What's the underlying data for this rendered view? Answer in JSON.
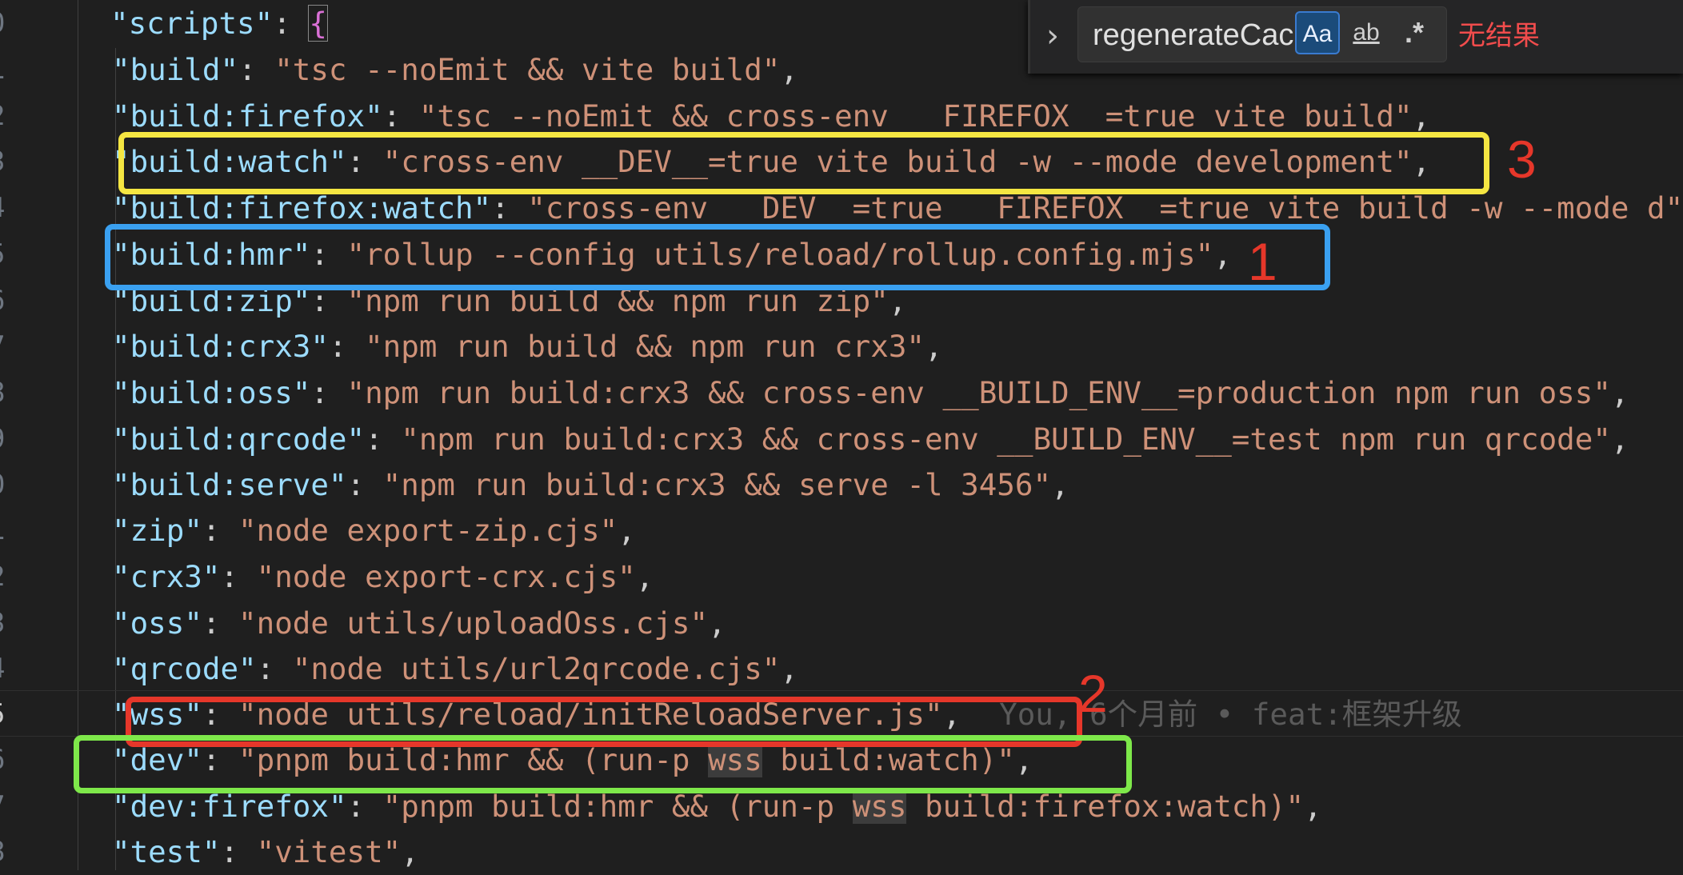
{
  "find_widget": {
    "query": "regenerateCac",
    "options": {
      "match_case": "Aa",
      "whole_word": "ab",
      "regex": ".*"
    },
    "result": "无结果"
  },
  "lines": [
    {
      "n": "0",
      "key": "scripts",
      "value": ""
    },
    {
      "n": "1",
      "key": "build",
      "value": "tsc --noEmit && vite build"
    },
    {
      "n": "2",
      "key": "build:firefox",
      "value": "tsc --noEmit && cross-env __FIREFOX__=true vite build"
    },
    {
      "n": "3",
      "key": "build:watch",
      "value": "cross-env __DEV__=true vite build -w --mode development"
    },
    {
      "n": "4",
      "key": "build:firefox:watch",
      "value": "cross-env __DEV__=true __FIREFOX__=true vite build -w --mode d"
    },
    {
      "n": "5",
      "key": "build:hmr",
      "value": "rollup --config utils/reload/rollup.config.mjs"
    },
    {
      "n": "6",
      "key": "build:zip",
      "value": "npm run build && npm run zip"
    },
    {
      "n": "7",
      "key": "build:crx3",
      "value": "npm run build && npm run crx3"
    },
    {
      "n": "8",
      "key": "build:oss",
      "value": "npm run build:crx3 && cross-env __BUILD_ENV__=production npm run oss"
    },
    {
      "n": "9",
      "key": "build:qrcode",
      "value": "npm run build:crx3 && cross-env __BUILD_ENV__=test npm run qrcode"
    },
    {
      "n": "0",
      "key": "build:serve",
      "value": "npm run build:crx3 && serve -l 3456"
    },
    {
      "n": "1",
      "key": "zip",
      "value": "node export-zip.cjs"
    },
    {
      "n": "2",
      "key": "crx3",
      "value": "node export-crx.cjs"
    },
    {
      "n": "3",
      "key": "oss",
      "value": "node utils/uploadOss.cjs"
    },
    {
      "n": "4",
      "key": "qrcode",
      "value": "node utils/url2qrcode.cjs"
    },
    {
      "n": "5",
      "key": "wss",
      "value": "node utils/reload/initReloadServer.js"
    },
    {
      "n": "6",
      "key": "dev",
      "value": "pnpm build:hmr && (run-p wss build:watch)"
    },
    {
      "n": "7",
      "key": "dev:firefox",
      "value": "pnpm build:hmr && (run-p wss build:firefox:watch)"
    },
    {
      "n": "8",
      "key": "test",
      "value": "vitest"
    }
  ],
  "blame": "You, 6个月前 • feat:框架升级",
  "annotations": [
    {
      "number": "3",
      "color": "#f5e642"
    },
    {
      "number": "1",
      "color": "#3aa0f0"
    },
    {
      "number": "2",
      "color": "#e6372a"
    },
    {
      "number": "",
      "color": "#7ee84a"
    }
  ]
}
